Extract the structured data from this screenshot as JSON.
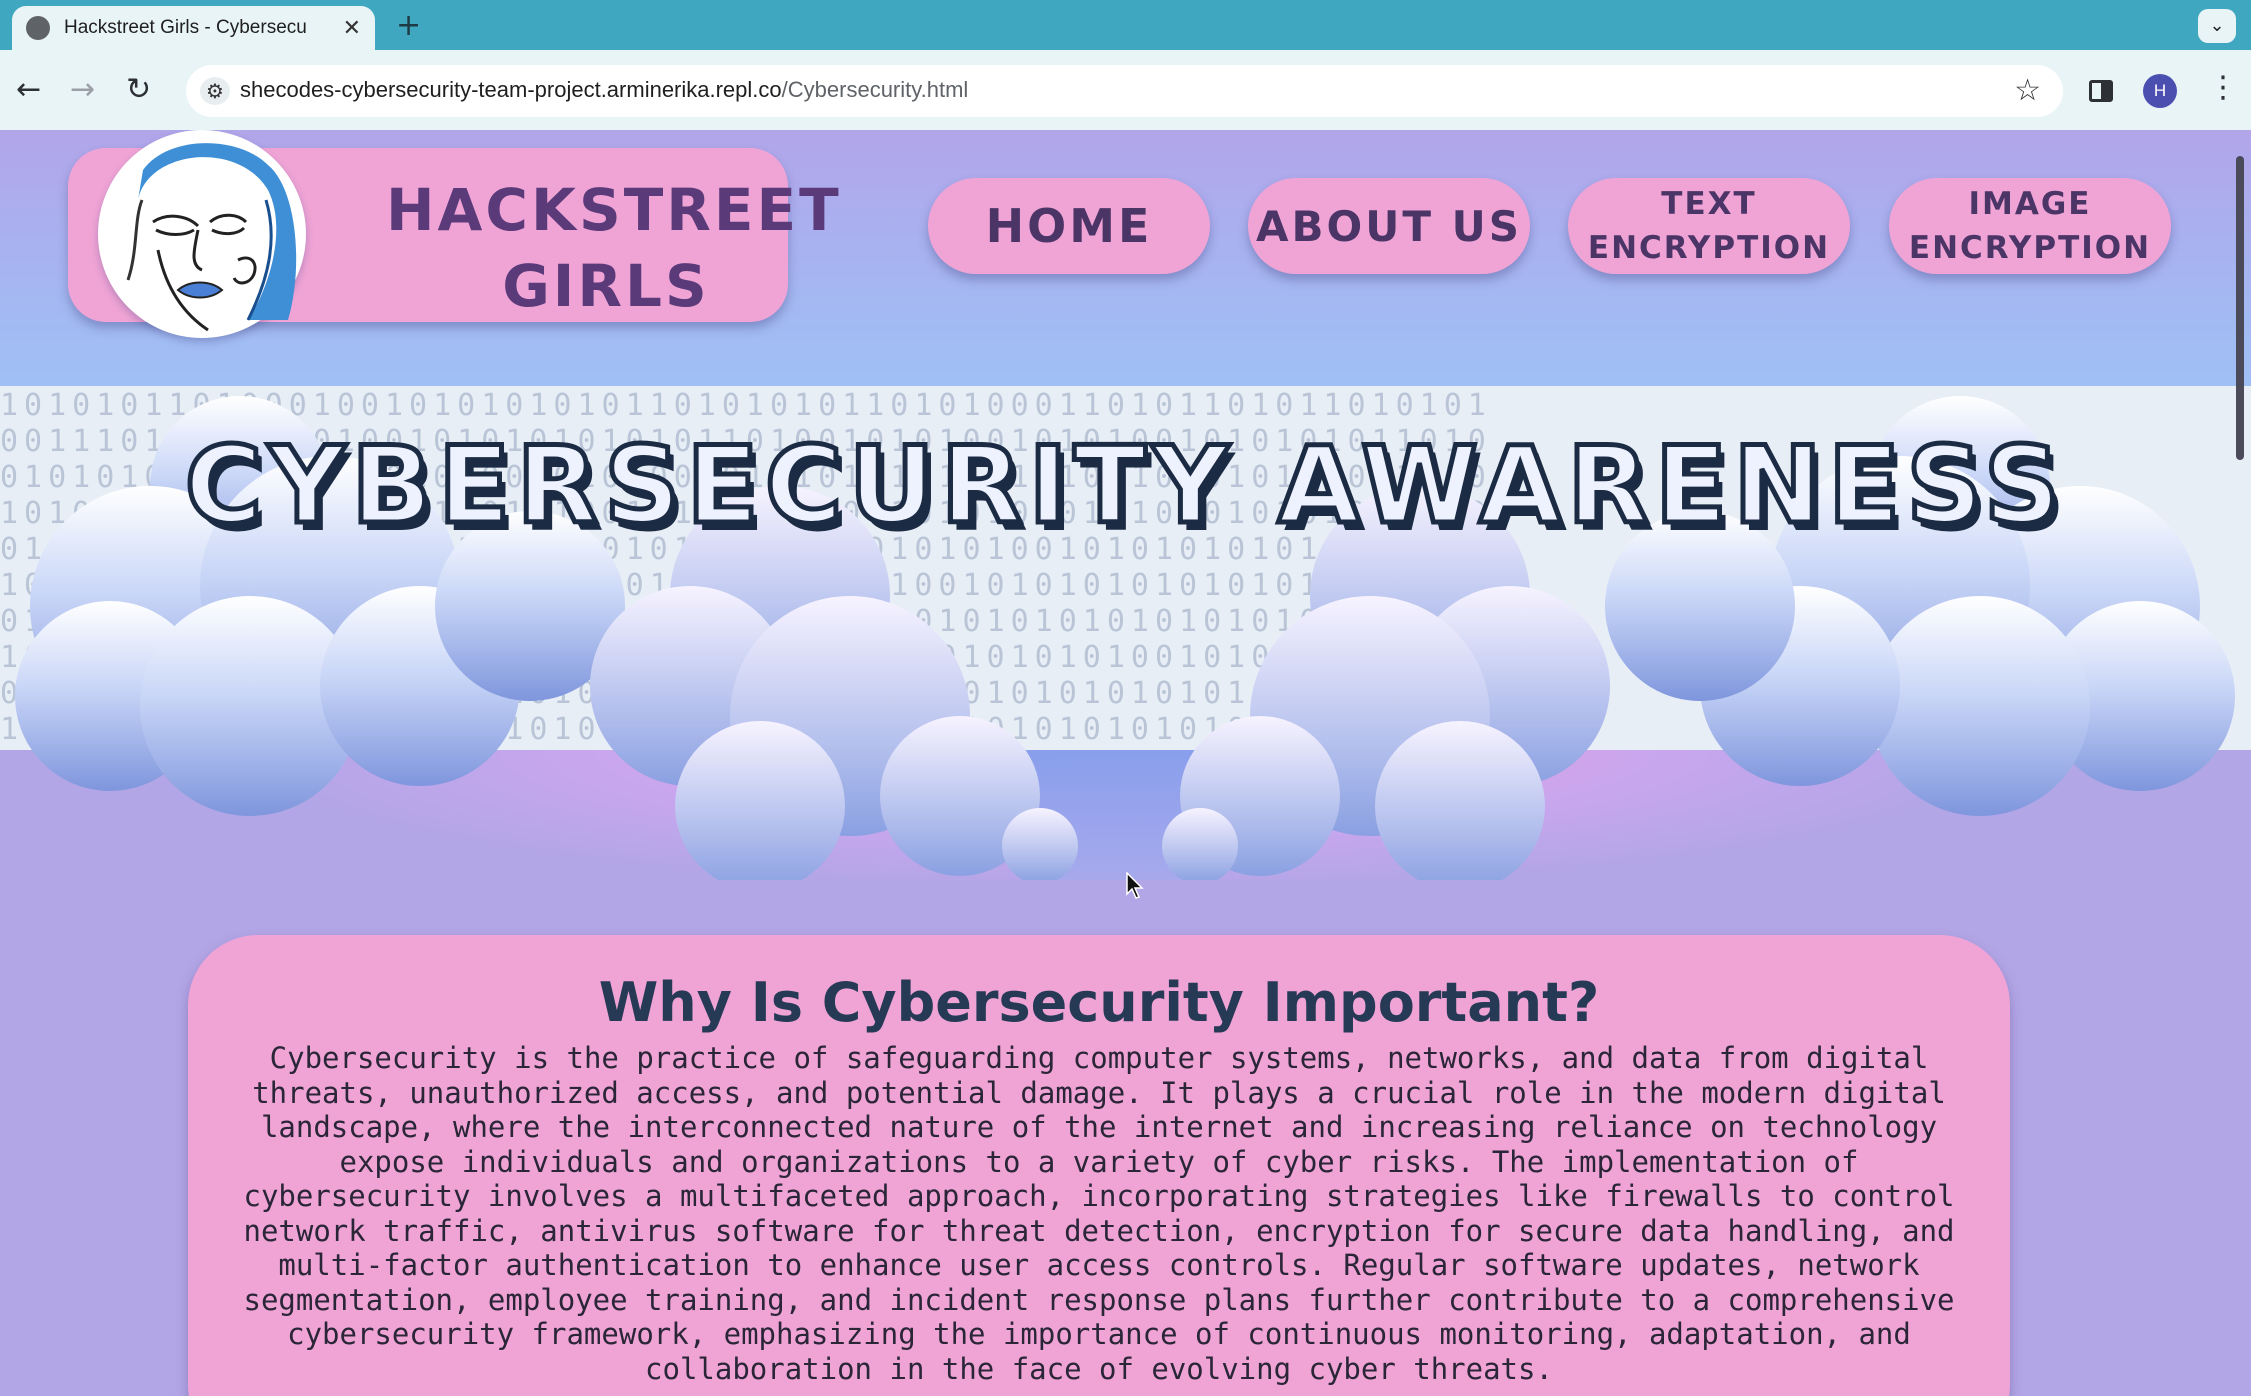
{
  "browser": {
    "tab_title": "Hackstreet Girls - Cybersecu",
    "tab_close": "✕",
    "new_tab": "+",
    "tab_menu": "⌄",
    "url_host": "shecodes-cybersecurity-team-project.arminerika.repl.co",
    "url_path": "/Cybersecurity.html",
    "back": "←",
    "forward": "→",
    "reload": "↻",
    "bookmark": "☆",
    "profile_initial": "H",
    "menu": "⋮"
  },
  "brand": {
    "name_line1": "HACKSTREET",
    "name_line2": "GIRLS"
  },
  "nav": {
    "home": "HOME",
    "about": "ABOUT US",
    "text_enc_line1": "TEXT",
    "text_enc_line2": "ENCRYPTION",
    "image_enc_line1": "IMAGE",
    "image_enc_line2": "ENCRYPTION"
  },
  "hero": {
    "title": "CYBERSECURITY AWARENESS"
  },
  "section": {
    "title": "Why Is Cybersecurity Important?",
    "body": "Cybersecurity is the practice of safeguarding computer systems, networks, and data from digital threats, unauthorized access, and potential damage. It plays a crucial role in the modern digital landscape, where the interconnected nature of the internet and increasing reliance on technology expose individuals and organizations to a variety of cyber risks. The implementation of cybersecurity involves a multifaceted approach, incorporating strategies like firewalls to control network traffic, antivirus software for threat detection, encryption for secure data handling, and multi-factor authentication to enhance user access controls. Regular software updates, network segmentation, employee training, and incident response plans further contribute to a comprehensive cybersecurity framework, emphasizing the importance of continuous monitoring, adaptation, and collaboration in the face of evolving cyber threats."
  },
  "colors": {
    "chrome": "#3fa7bf",
    "pill": "#f0a4d6",
    "page_bg": "#b3a6e6",
    "title_ink": "#1c2b44"
  },
  "icons": {
    "favicon": "globe-icon",
    "site_info": "tune-icon",
    "side_panel": "side-panel-icon"
  }
}
